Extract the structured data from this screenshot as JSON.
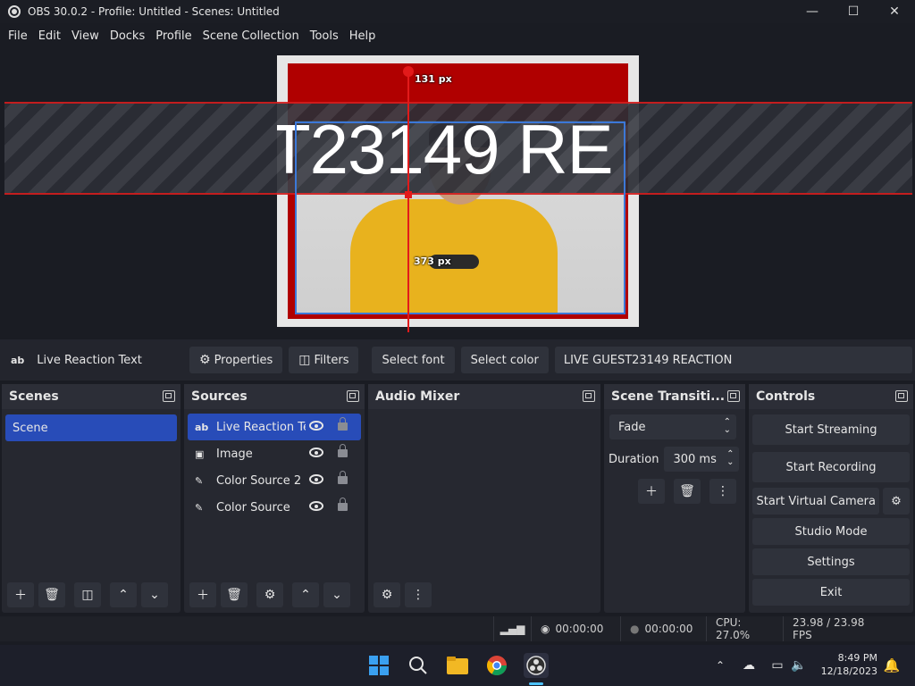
{
  "window": {
    "title": "OBS 30.0.2 - Profile: Untitled - Scenes: Untitled",
    "minimize": "—",
    "maximize": "☐",
    "close": "✕"
  },
  "menu": [
    "File",
    "Edit",
    "View",
    "Docks",
    "Profile",
    "Scene Collection",
    "Tools",
    "Help"
  ],
  "preview": {
    "overlay_text": "T23149 RE",
    "top_distance": "131 px",
    "bottom_distance": "373 px"
  },
  "context_bar": {
    "source_icon": "ab",
    "source_name": "Live Reaction Text",
    "properties": "Properties",
    "filters": "Filters",
    "select_font": "Select font",
    "select_color": "Select color",
    "text_value": "LIVE GUEST23149 REACTION"
  },
  "scenes": {
    "title": "Scenes",
    "items": [
      "Scene"
    ]
  },
  "sources": {
    "title": "Sources",
    "items": [
      {
        "icon": "ab",
        "name": "Live Reaction Text"
      },
      {
        "icon": "▣",
        "name": "Image"
      },
      {
        "icon": "✎",
        "name": "Color Source 2"
      },
      {
        "icon": "✎",
        "name": "Color Source"
      }
    ]
  },
  "audio_mixer": {
    "title": "Audio Mixer"
  },
  "transitions": {
    "title": "Scene Transiti...",
    "type": "Fade",
    "duration_label": "Duration",
    "duration_value": "300 ms"
  },
  "controls": {
    "title": "Controls",
    "start_streaming": "Start Streaming",
    "start_recording": "Start Recording",
    "start_virtual_camera": "Start Virtual Camera",
    "studio_mode": "Studio Mode",
    "settings": "Settings",
    "exit": "Exit"
  },
  "status": {
    "stream_time": "00:00:00",
    "rec_time": "00:00:00",
    "cpu": "CPU: 27.0%",
    "fps": "23.98 / 23.98 FPS"
  },
  "taskbar": {
    "time": "8:49 PM",
    "date": "12/18/2023"
  }
}
